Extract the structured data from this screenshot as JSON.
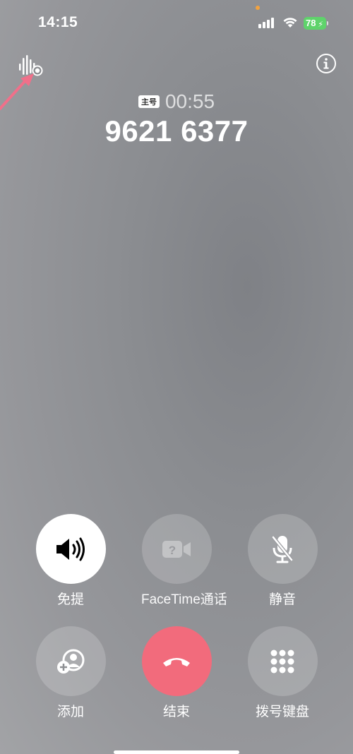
{
  "status_bar": {
    "time": "14:15",
    "battery": "78"
  },
  "call": {
    "sim_label": "主号",
    "duration": "00:55",
    "number": "9621 6377"
  },
  "buttons": {
    "speaker": "免提",
    "facetime": "FaceTime通话",
    "mute": "静音",
    "add": "添加",
    "end": "结束",
    "keypad": "拨号键盘"
  },
  "colors": {
    "end_call": "#f26b7c",
    "battery": "#5fd36b",
    "annotation_arrow": "#f0708a"
  },
  "icons": {
    "speaker": "speaker-wave-icon",
    "facetime": "video-question-icon",
    "mute": "mic-slash-icon",
    "add": "person-add-icon",
    "end": "phone-down-icon",
    "keypad": "keypad-grid-icon",
    "info": "info-icon",
    "audio": "audio-wave-icon"
  }
}
